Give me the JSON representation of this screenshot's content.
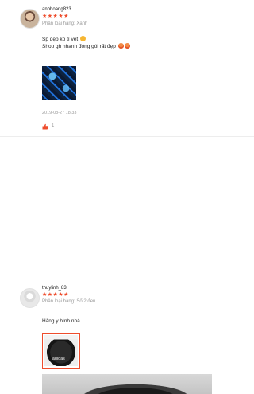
{
  "reviews": [
    {
      "username": "anhhoang823",
      "stars": "★★★★★",
      "variation": "Phân loại hàng: Xanh",
      "comment_lines": [
        "Sp đẹp ko tì vết",
        "Shop gh nhanh đóng gói rất đẹp",
        "............"
      ],
      "timestamp": "2019-08-27 18:33",
      "like_count": "1"
    },
    {
      "username": "thuylinh_83",
      "stars": "★★★★★",
      "variation": "Phân loại hàng: Số 2 đen",
      "comment_lines": [
        "Hàng y hình nhá."
      ],
      "photo_brand": "adidas"
    }
  ],
  "colors": {
    "accent": "#ee4d2d",
    "muted_text": "#9a9a9a"
  },
  "icons": {
    "like": "thumbs-up-icon",
    "emoji_1": "grinning-emoji-icon",
    "emoji_2": "heart-eyes-emoji-icon"
  }
}
